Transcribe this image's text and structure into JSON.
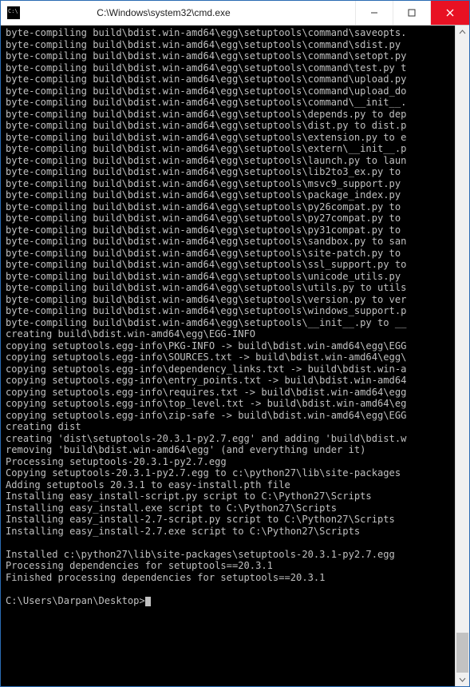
{
  "window": {
    "title": "C:\\Windows\\system32\\cmd.exe"
  },
  "prompt": "C:\\Users\\Darpan\\Desktop>",
  "lines": [
    "byte-compiling build\\bdist.win-amd64\\egg\\setuptools\\command\\saveopts.",
    "byte-compiling build\\bdist.win-amd64\\egg\\setuptools\\command\\sdist.py ",
    "byte-compiling build\\bdist.win-amd64\\egg\\setuptools\\command\\setopt.py",
    "byte-compiling build\\bdist.win-amd64\\egg\\setuptools\\command\\test.py t",
    "byte-compiling build\\bdist.win-amd64\\egg\\setuptools\\command\\upload.py",
    "byte-compiling build\\bdist.win-amd64\\egg\\setuptools\\command\\upload_do",
    "byte-compiling build\\bdist.win-amd64\\egg\\setuptools\\command\\__init__.",
    "byte-compiling build\\bdist.win-amd64\\egg\\setuptools\\depends.py to dep",
    "byte-compiling build\\bdist.win-amd64\\egg\\setuptools\\dist.py to dist.p",
    "byte-compiling build\\bdist.win-amd64\\egg\\setuptools\\extension.py to e",
    "byte-compiling build\\bdist.win-amd64\\egg\\setuptools\\extern\\__init__.p",
    "byte-compiling build\\bdist.win-amd64\\egg\\setuptools\\launch.py to laun",
    "byte-compiling build\\bdist.win-amd64\\egg\\setuptools\\lib2to3_ex.py to ",
    "byte-compiling build\\bdist.win-amd64\\egg\\setuptools\\msvc9_support.py ",
    "byte-compiling build\\bdist.win-amd64\\egg\\setuptools\\package_index.py ",
    "byte-compiling build\\bdist.win-amd64\\egg\\setuptools\\py26compat.py to ",
    "byte-compiling build\\bdist.win-amd64\\egg\\setuptools\\py27compat.py to ",
    "byte-compiling build\\bdist.win-amd64\\egg\\setuptools\\py31compat.py to ",
    "byte-compiling build\\bdist.win-amd64\\egg\\setuptools\\sandbox.py to san",
    "byte-compiling build\\bdist.win-amd64\\egg\\setuptools\\site-patch.py to ",
    "byte-compiling build\\bdist.win-amd64\\egg\\setuptools\\ssl_support.py to",
    "byte-compiling build\\bdist.win-amd64\\egg\\setuptools\\unicode_utils.py ",
    "byte-compiling build\\bdist.win-amd64\\egg\\setuptools\\utils.py to utils",
    "byte-compiling build\\bdist.win-amd64\\egg\\setuptools\\version.py to ver",
    "byte-compiling build\\bdist.win-amd64\\egg\\setuptools\\windows_support.p",
    "byte-compiling build\\bdist.win-amd64\\egg\\setuptools\\__init__.py to __",
    "creating build\\bdist.win-amd64\\egg\\EGG-INFO",
    "copying setuptools.egg-info\\PKG-INFO -> build\\bdist.win-amd64\\egg\\EGG",
    "copying setuptools.egg-info\\SOURCES.txt -> build\\bdist.win-amd64\\egg\\",
    "copying setuptools.egg-info\\dependency_links.txt -> build\\bdist.win-a",
    "copying setuptools.egg-info\\entry_points.txt -> build\\bdist.win-amd64",
    "copying setuptools.egg-info\\requires.txt -> build\\bdist.win-amd64\\egg",
    "copying setuptools.egg-info\\top_level.txt -> build\\bdist.win-amd64\\eg",
    "copying setuptools.egg-info\\zip-safe -> build\\bdist.win-amd64\\egg\\EGG",
    "creating dist",
    "creating 'dist\\setuptools-20.3.1-py2.7.egg' and adding 'build\\bdist.w",
    "removing 'build\\bdist.win-amd64\\egg' (and everything under it)",
    "Processing setuptools-20.3.1-py2.7.egg",
    "Copying setuptools-20.3.1-py2.7.egg to c:\\python27\\lib\\site-packages",
    "Adding setuptools 20.3.1 to easy-install.pth file",
    "Installing easy_install-script.py script to C:\\Python27\\Scripts",
    "Installing easy_install.exe script to C:\\Python27\\Scripts",
    "Installing easy_install-2.7-script.py script to C:\\Python27\\Scripts",
    "Installing easy_install-2.7.exe script to C:\\Python27\\Scripts",
    "",
    "Installed c:\\python27\\lib\\site-packages\\setuptools-20.3.1-py2.7.egg",
    "Processing dependencies for setuptools==20.3.1",
    "Finished processing dependencies for setuptools==20.3.1",
    ""
  ]
}
